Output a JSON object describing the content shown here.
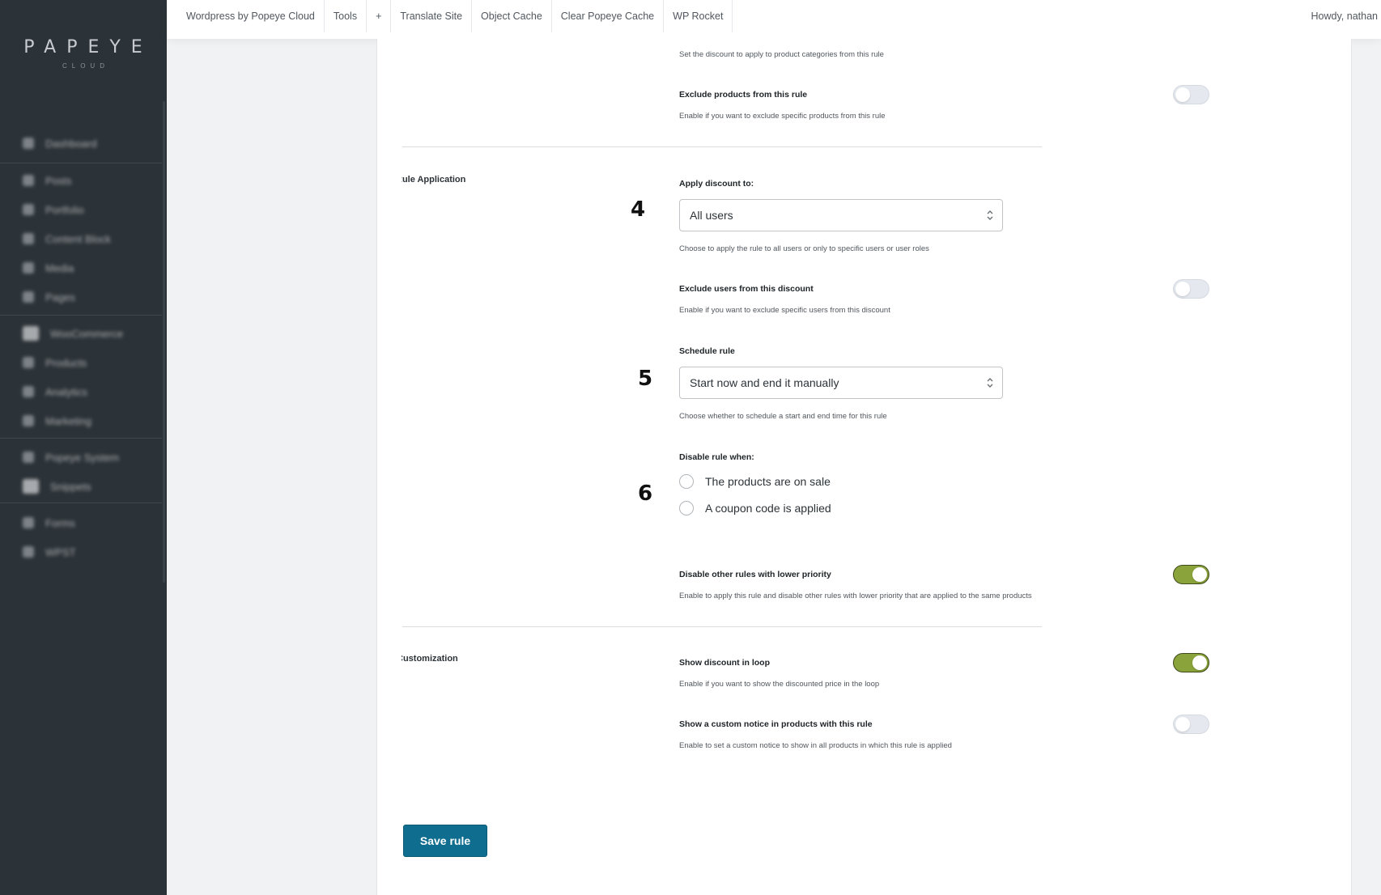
{
  "brand": {
    "logo": "PAPEYE",
    "logo_sub": "CLOUD"
  },
  "sidebar": {
    "items": [
      {
        "label": "Dashboard",
        "icon": "dashboard-icon"
      },
      {
        "label": "Posts",
        "icon": "pin-icon"
      },
      {
        "label": "Portfolio",
        "icon": "portfolio-icon"
      },
      {
        "label": "Content Block",
        "icon": "block-icon"
      },
      {
        "label": "Media",
        "icon": "media-icon"
      },
      {
        "label": "Pages",
        "icon": "pages-icon"
      },
      {
        "label": "WooCommerce",
        "icon": "woocommerce-icon"
      },
      {
        "label": "Products",
        "icon": "products-icon"
      },
      {
        "label": "Analytics",
        "icon": "analytics-icon"
      },
      {
        "label": "Marketing",
        "icon": "megaphone-icon"
      },
      {
        "label": "Popeye System",
        "icon": "system-icon"
      },
      {
        "label": "Snippets",
        "icon": "snippets-icon"
      },
      {
        "label": "Forms",
        "icon": "forms-icon"
      },
      {
        "label": "WPST",
        "icon": "wpst-icon"
      }
    ]
  },
  "topbar": {
    "links": [
      "Wordpress by Popeye Cloud",
      "Tools",
      "+",
      "Translate Site",
      "Object Cache",
      "Clear Popeye Cache",
      "WP Rocket"
    ],
    "howdy": "Howdy, nathan"
  },
  "form": {
    "categories_desc": "Set the discount to apply to product categories from this rule",
    "exclude_products": {
      "title": "Exclude products from this rule",
      "desc": "Enable if you want to exclude specific products from this rule",
      "enabled": false
    },
    "rule_application": {
      "section_label": "Rule Application",
      "apply_to": {
        "step": "4",
        "title": "Apply discount to:",
        "value": "All users",
        "desc": "Choose to apply the rule to all users or only to specific users or user roles"
      },
      "exclude_users": {
        "title": "Exclude users from this discount",
        "desc": "Enable if you want to exclude specific users from this discount",
        "enabled": false
      },
      "schedule": {
        "step": "5",
        "title": "Schedule rule",
        "value": "Start now and end it manually",
        "desc": "Choose whether to schedule a start and end time for this rule"
      },
      "disable_when": {
        "step": "6",
        "title": "Disable rule when:",
        "options": [
          "The products are on sale",
          "A coupon code is applied"
        ]
      },
      "disable_lower": {
        "title": "Disable other rules with lower priority",
        "desc": "Enable to apply this rule and disable other rules with lower priority that are applied to the same products",
        "enabled": true
      }
    },
    "customization": {
      "section_label": "Customization",
      "show_loop": {
        "title": "Show discount in loop",
        "desc": "Enable if you want to show the discounted price in the loop",
        "enabled": true
      },
      "custom_notice": {
        "title": "Show a custom notice in products with this rule",
        "desc": "Enable to set a custom notice to show in all products in which this rule is applied",
        "enabled": false
      }
    },
    "save_label": "Save rule"
  },
  "colors": {
    "sidebar": "#2c3338",
    "toggle_on": "#8aa33a",
    "primary_button": "#0f6e8f"
  }
}
